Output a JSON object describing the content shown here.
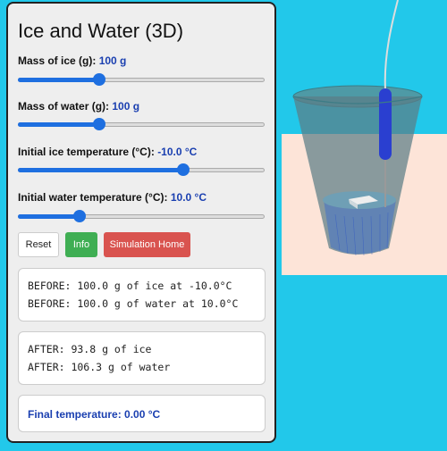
{
  "panel": {
    "title": "Ice and Water (3D)",
    "sliders": [
      {
        "label": "Mass of ice (g):",
        "value": "100 g",
        "fraction": 0.33
      },
      {
        "label": "Mass of water (g):",
        "value": "100 g",
        "fraction": 0.33
      },
      {
        "label": "Initial ice temperature (°C):",
        "value": "-10.0 °C",
        "fraction": 0.67
      },
      {
        "label": "Initial water temperature (°C):",
        "value": "10.0 °C",
        "fraction": 0.25
      }
    ],
    "buttons": {
      "reset": "Reset",
      "info": "Info",
      "home": "Simulation Home"
    },
    "before": [
      "BEFORE: 100.0 g of ice at -10.0°C",
      "BEFORE: 100.0 g of water at 10.0°C"
    ],
    "after": [
      "AFTER: 93.8 g of ice",
      "AFTER: 106.3 g of water"
    ],
    "final_temperature": "Final temperature: 0.00 °C"
  },
  "colors": {
    "background": "#22c8ea",
    "panel": "#eeeeee",
    "accent": "#1e6fe0",
    "info_button": "#3fae53",
    "home_button": "#d9534f",
    "value_text": "#1a3fb0"
  },
  "scene": {
    "objects": [
      "cup",
      "water",
      "ice-cube",
      "thermometer",
      "table"
    ]
  }
}
